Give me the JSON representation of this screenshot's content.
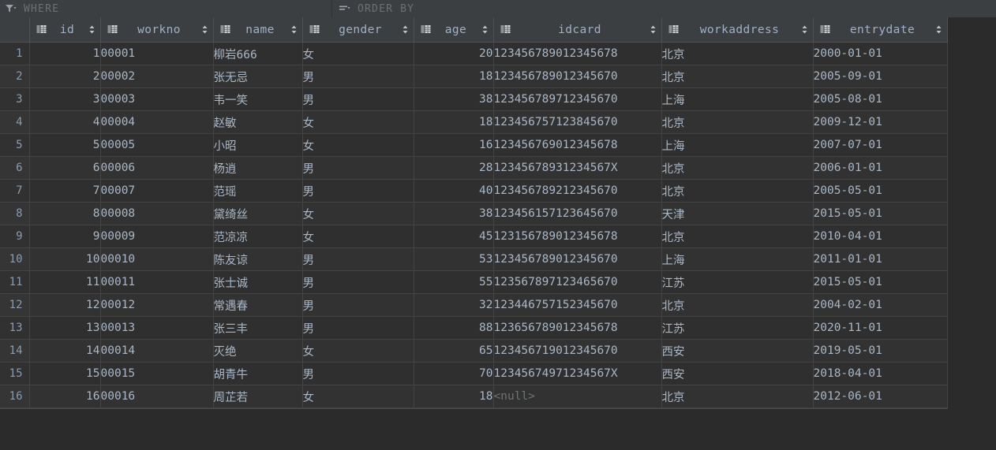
{
  "toolbar": {
    "where_label": "WHERE",
    "where_icon": "filter-funnel-icon",
    "order_label": "ORDER BY",
    "order_icon": "sort-lines-icon"
  },
  "grid": {
    "row_number_header": "",
    "columns": [
      {
        "name": "id",
        "icon": "table-column-icon",
        "align": "right",
        "sortable": true
      },
      {
        "name": "workno",
        "icon": "table-column-icon",
        "align": "left",
        "sortable": true
      },
      {
        "name": "name",
        "icon": "table-column-icon",
        "align": "left",
        "sortable": true
      },
      {
        "name": "gender",
        "icon": "table-column-icon",
        "align": "left",
        "sortable": true
      },
      {
        "name": "age",
        "icon": "table-column-icon",
        "align": "right",
        "sortable": true
      },
      {
        "name": "idcard",
        "icon": "table-column-icon",
        "align": "left",
        "sortable": true
      },
      {
        "name": "workaddress",
        "icon": "table-column-icon",
        "align": "left",
        "sortable": true
      },
      {
        "name": "entrydate",
        "icon": "table-column-icon",
        "align": "left",
        "sortable": true
      }
    ],
    "rows": [
      {
        "n": "1",
        "id": "1",
        "workno": "00001",
        "name": "柳岩666",
        "gender": "女",
        "age": "20",
        "idcard": "123456789012345678",
        "workaddress": "北京",
        "entrydate": "2000-01-01"
      },
      {
        "n": "2",
        "id": "2",
        "workno": "00002",
        "name": "张无忌",
        "gender": "男",
        "age": "18",
        "idcard": "123456789012345670",
        "workaddress": "北京",
        "entrydate": "2005-09-01"
      },
      {
        "n": "3",
        "id": "3",
        "workno": "00003",
        "name": "韦一笑",
        "gender": "男",
        "age": "38",
        "idcard": "123456789712345670",
        "workaddress": "上海",
        "entrydate": "2005-08-01"
      },
      {
        "n": "4",
        "id": "4",
        "workno": "00004",
        "name": "赵敏",
        "gender": "女",
        "age": "18",
        "idcard": "123456757123845670",
        "workaddress": "北京",
        "entrydate": "2009-12-01"
      },
      {
        "n": "5",
        "id": "5",
        "workno": "00005",
        "name": "小昭",
        "gender": "女",
        "age": "16",
        "idcard": "123456769012345678",
        "workaddress": "上海",
        "entrydate": "2007-07-01"
      },
      {
        "n": "6",
        "id": "6",
        "workno": "00006",
        "name": "杨逍",
        "gender": "男",
        "age": "28",
        "idcard": "12345678931234567X",
        "workaddress": "北京",
        "entrydate": "2006-01-01"
      },
      {
        "n": "7",
        "id": "7",
        "workno": "00007",
        "name": "范瑶",
        "gender": "男",
        "age": "40",
        "idcard": "123456789212345670",
        "workaddress": "北京",
        "entrydate": "2005-05-01"
      },
      {
        "n": "8",
        "id": "8",
        "workno": "00008",
        "name": "黛绮丝",
        "gender": "女",
        "age": "38",
        "idcard": "123456157123645670",
        "workaddress": "天津",
        "entrydate": "2015-05-01"
      },
      {
        "n": "9",
        "id": "9",
        "workno": "00009",
        "name": "范凉凉",
        "gender": "女",
        "age": "45",
        "idcard": "123156789012345678",
        "workaddress": "北京",
        "entrydate": "2010-04-01"
      },
      {
        "n": "10",
        "id": "10",
        "workno": "00010",
        "name": "陈友谅",
        "gender": "男",
        "age": "53",
        "idcard": "123456789012345670",
        "workaddress": "上海",
        "entrydate": "2011-01-01"
      },
      {
        "n": "11",
        "id": "11",
        "workno": "00011",
        "name": "张士诚",
        "gender": "男",
        "age": "55",
        "idcard": "123567897123465670",
        "workaddress": "江苏",
        "entrydate": "2015-05-01"
      },
      {
        "n": "12",
        "id": "12",
        "workno": "00012",
        "name": "常遇春",
        "gender": "男",
        "age": "32",
        "idcard": "123446757152345670",
        "workaddress": "北京",
        "entrydate": "2004-02-01"
      },
      {
        "n": "13",
        "id": "13",
        "workno": "00013",
        "name": "张三丰",
        "gender": "男",
        "age": "88",
        "idcard": "123656789012345678",
        "workaddress": "江苏",
        "entrydate": "2020-11-01"
      },
      {
        "n": "14",
        "id": "14",
        "workno": "00014",
        "name": "灭绝",
        "gender": "女",
        "age": "65",
        "idcard": "123456719012345670",
        "workaddress": "西安",
        "entrydate": "2019-05-01"
      },
      {
        "n": "15",
        "id": "15",
        "workno": "00015",
        "name": "胡青牛",
        "gender": "男",
        "age": "70",
        "idcard": "12345674971234567X",
        "workaddress": "西安",
        "entrydate": "2018-04-01"
      },
      {
        "n": "16",
        "id": "16",
        "workno": "00016",
        "name": "周芷若",
        "gender": "女",
        "age": "18",
        "idcard": "<null>",
        "workaddress": "北京",
        "entrydate": "2012-06-01"
      }
    ]
  },
  "colors": {
    "background": "#2b2b2b",
    "header_background": "#3c3f41",
    "row_background": "#2f2f2f",
    "row_alt_background": "#323232",
    "text": "#a9b7c6",
    "header_text": "#a0b0c8",
    "muted_text": "#6d7072",
    "grid_line": "#444444"
  }
}
